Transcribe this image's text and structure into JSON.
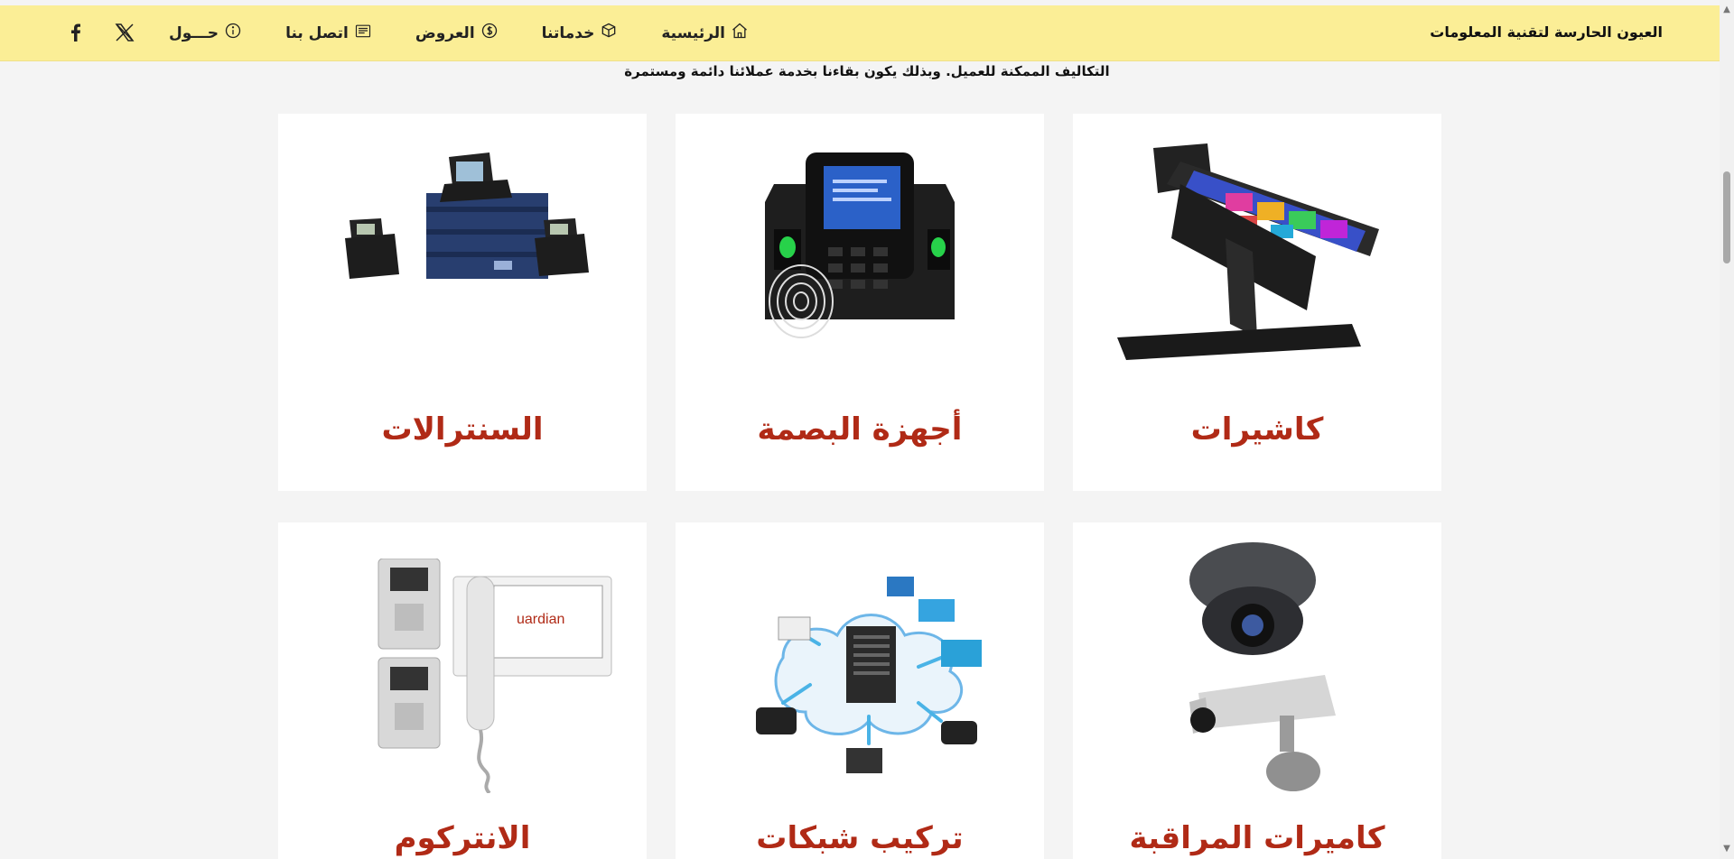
{
  "nav": {
    "brand": "العيون الحارسة لتقنية المعلومات",
    "items": [
      {
        "label": "الرئيسية",
        "icon": "home-icon"
      },
      {
        "label": "خدماتنا",
        "icon": "box-icon"
      },
      {
        "label": "العروض",
        "icon": "dollar-icon"
      },
      {
        "label": "اتصل بنا",
        "icon": "contact-card-icon"
      },
      {
        "label": "حـــول",
        "icon": "info-icon"
      }
    ],
    "social": [
      {
        "icon": "facebook-icon"
      },
      {
        "icon": "x-icon"
      }
    ]
  },
  "intro": {
    "text": "التكاليف الممكنة للعميل. وبذلك يكون بقاءنا بخدمة عملائنا دائمة ومستمرة"
  },
  "cards": [
    {
      "title": "كاشيرات",
      "image": "pos-cashier-icon"
    },
    {
      "title": "أجهزة البصمة",
      "image": "fingerprint-device-icon"
    },
    {
      "title": "السنترالات",
      "image": "pbx-phone-system-icon"
    },
    {
      "title": "كاميرات المراقبة",
      "image": "cctv-camera-icon"
    },
    {
      "title": "تركيب شبكات",
      "image": "network-cloud-icon"
    },
    {
      "title": "الانتركوم",
      "image": "intercom-icon"
    }
  ],
  "colors": {
    "navbar_bg": "#fbee96",
    "card_title": "#b02a16",
    "page_bg": "#f4f4f4"
  }
}
